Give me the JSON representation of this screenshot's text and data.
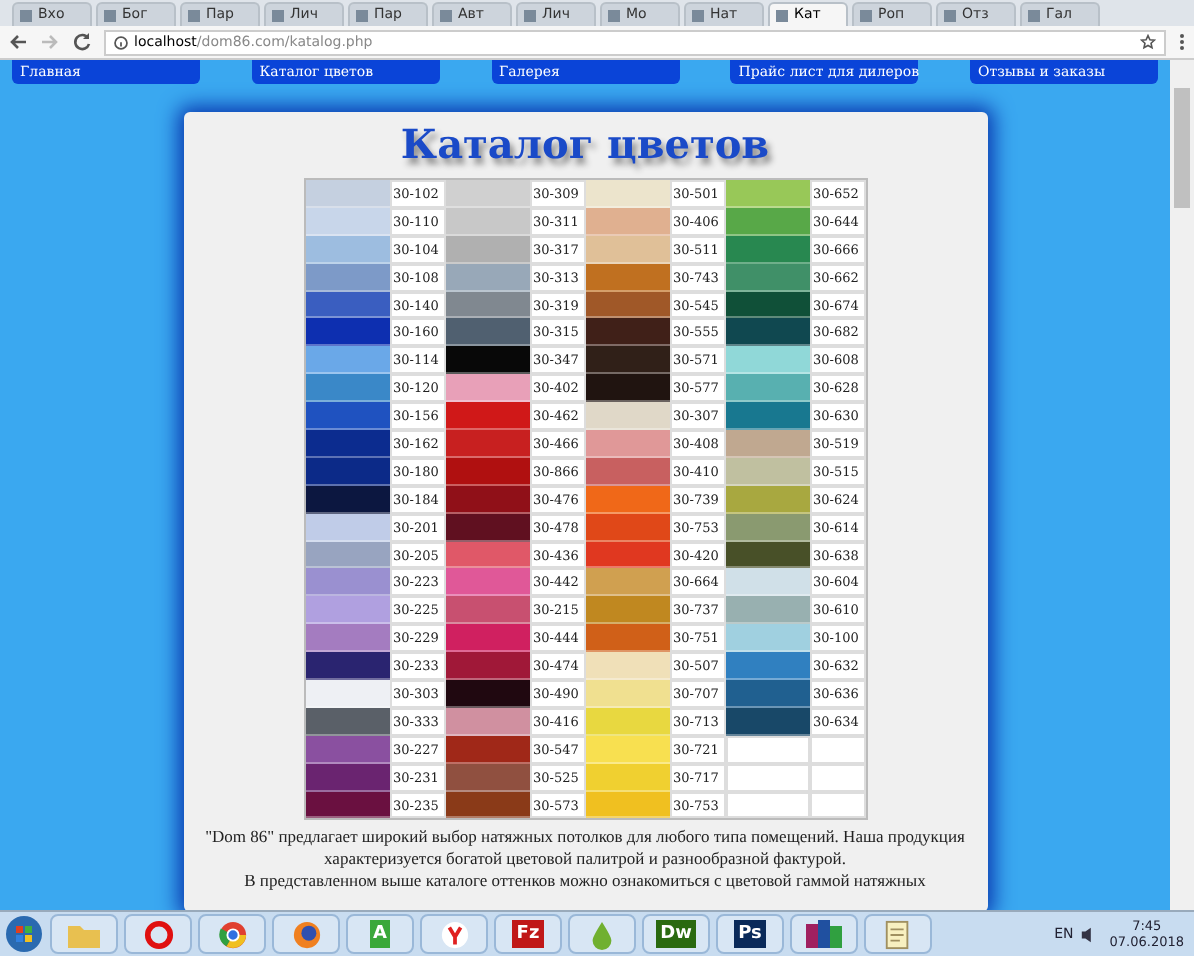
{
  "browser": {
    "tabs": [
      {
        "label": "Вхо",
        "selected": false
      },
      {
        "label": "Бог",
        "selected": false
      },
      {
        "label": "Пар",
        "selected": false
      },
      {
        "label": "Лич",
        "selected": false
      },
      {
        "label": "Пар",
        "selected": false
      },
      {
        "label": "Авт",
        "selected": false
      },
      {
        "label": "Лич",
        "selected": false
      },
      {
        "label": "Мо",
        "selected": false
      },
      {
        "label": "Нат",
        "selected": false
      },
      {
        "label": "Кат",
        "selected": true
      },
      {
        "label": "Роп",
        "selected": false
      },
      {
        "label": "Отз",
        "selected": false
      },
      {
        "label": "Гал",
        "selected": false
      }
    ],
    "url_host": "localhost",
    "url_path": "/dom86.com/katalog.php"
  },
  "nav": [
    "Главная",
    "Каталог цветов",
    "Галерея",
    "Прайс лист для дилеров",
    "Отзывы и заказы"
  ],
  "title": "Каталог цветов",
  "palette": [
    [
      {
        "code": "30-102",
        "color": "#c5d0e0"
      },
      {
        "code": "30-110",
        "color": "#c8d6ea"
      },
      {
        "code": "30-104",
        "color": "#9dbde0"
      },
      {
        "code": "30-108",
        "color": "#7d9ac8"
      },
      {
        "code": "30-140",
        "color": "#3a5ec0"
      },
      {
        "code": "30-160",
        "color": "#0d2fb0"
      },
      {
        "code": "30-114",
        "color": "#6aa8e8"
      },
      {
        "code": "30-120",
        "color": "#3a88c8"
      },
      {
        "code": "30-156",
        "color": "#1f52c0"
      },
      {
        "code": "30-162",
        "color": "#0c2c8f"
      },
      {
        "code": "30-180",
        "color": "#0c2a88"
      },
      {
        "code": "30-184",
        "color": "#0c1740"
      },
      {
        "code": "30-201",
        "color": "#c0cce8"
      },
      {
        "code": "30-205",
        "color": "#98a4c0"
      },
      {
        "code": "30-223",
        "color": "#9a90d0"
      },
      {
        "code": "30-225",
        "color": "#b0a0e0"
      },
      {
        "code": "30-229",
        "color": "#a47cc0"
      },
      {
        "code": "30-233",
        "color": "#2a2470"
      },
      {
        "code": "30-303",
        "color": "#eef0f4"
      },
      {
        "code": "30-333",
        "color": "#5a6068"
      },
      {
        "code": "30-227",
        "color": "#8a50a0"
      },
      {
        "code": "30-231",
        "color": "#6a2470"
      },
      {
        "code": "30-235",
        "color": "#6a1040"
      }
    ],
    [
      {
        "code": "30-309",
        "color": "#d0d0d0"
      },
      {
        "code": "30-311",
        "color": "#c8c8c8"
      },
      {
        "code": "30-317",
        "color": "#b0b0b0"
      },
      {
        "code": "30-313",
        "color": "#98a8b8"
      },
      {
        "code": "30-319",
        "color": "#808890"
      },
      {
        "code": "30-315",
        "color": "#506070"
      },
      {
        "code": "30-347",
        "color": "#080808"
      },
      {
        "code": "30-402",
        "color": "#e8a0b8"
      },
      {
        "code": "30-462",
        "color": "#d01818"
      },
      {
        "code": "30-466",
        "color": "#c82020"
      },
      {
        "code": "30-866",
        "color": "#b01010"
      },
      {
        "code": "30-476",
        "color": "#901018"
      },
      {
        "code": "30-478",
        "color": "#601020"
      },
      {
        "code": "30-436",
        "color": "#e05868"
      },
      {
        "code": "30-442",
        "color": "#e05898"
      },
      {
        "code": "30-215",
        "color": "#c85070"
      },
      {
        "code": "30-444",
        "color": "#d02060"
      },
      {
        "code": "30-474",
        "color": "#a01838"
      },
      {
        "code": "30-490",
        "color": "#200810"
      },
      {
        "code": "30-416",
        "color": "#d090a0"
      },
      {
        "code": "30-547",
        "color": "#a02818"
      },
      {
        "code": "30-525",
        "color": "#905040"
      },
      {
        "code": "30-573",
        "color": "#8a3a18"
      }
    ],
    [
      {
        "code": "30-501",
        "color": "#ece4cc"
      },
      {
        "code": "30-406",
        "color": "#e0b090"
      },
      {
        "code": "30-511",
        "color": "#e0c098"
      },
      {
        "code": "30-743",
        "color": "#c07020"
      },
      {
        "code": "30-545",
        "color": "#a05828"
      },
      {
        "code": "30-555",
        "color": "#402018"
      },
      {
        "code": "30-571",
        "color": "#302018"
      },
      {
        "code": "30-577",
        "color": "#201410"
      },
      {
        "code": "30-307",
        "color": "#e0d8c8"
      },
      {
        "code": "30-408",
        "color": "#e09898"
      },
      {
        "code": "30-410",
        "color": "#c86060"
      },
      {
        "code": "30-739",
        "color": "#f06818"
      },
      {
        "code": "30-753",
        "color": "#e04818"
      },
      {
        "code": "30-420",
        "color": "#e03820"
      },
      {
        "code": "30-664",
        "color": "#d0a050"
      },
      {
        "code": "30-737",
        "color": "#c08820"
      },
      {
        "code": "30-751",
        "color": "#d06018"
      },
      {
        "code": "30-507",
        "color": "#f0e0b8"
      },
      {
        "code": "30-707",
        "color": "#f0e090"
      },
      {
        "code": "30-713",
        "color": "#e8d840"
      },
      {
        "code": "30-721",
        "color": "#f8e050"
      },
      {
        "code": "30-717",
        "color": "#f0d030"
      },
      {
        "code": "30-753",
        "color": "#f0c020"
      }
    ],
    [
      {
        "code": "30-652",
        "color": "#98c858"
      },
      {
        "code": "30-644",
        "color": "#58a848"
      },
      {
        "code": "30-666",
        "color": "#288850"
      },
      {
        "code": "30-662",
        "color": "#409068"
      },
      {
        "code": "30-674",
        "color": "#105038"
      },
      {
        "code": "30-682",
        "color": "#104850"
      },
      {
        "code": "30-608",
        "color": "#90d8d8"
      },
      {
        "code": "30-628",
        "color": "#58b0b0"
      },
      {
        "code": "30-630",
        "color": "#187890"
      },
      {
        "code": "30-519",
        "color": "#c0a890"
      },
      {
        "code": "30-515",
        "color": "#c0c0a0"
      },
      {
        "code": "30-624",
        "color": "#a8a840"
      },
      {
        "code": "30-614",
        "color": "#8a9a70"
      },
      {
        "code": "30-638",
        "color": "#485028"
      },
      {
        "code": "30-604",
        "color": "#d0e0e8"
      },
      {
        "code": "30-610",
        "color": "#98b0b0"
      },
      {
        "code": "30-100",
        "color": "#a0d0e0"
      },
      {
        "code": "30-632",
        "color": "#3080c0"
      },
      {
        "code": "30-636",
        "color": "#206090"
      },
      {
        "code": "30-634",
        "color": "#184868"
      }
    ]
  ],
  "description": [
    "\"Dom 86\" предлагает широкий выбор натяжных потолков для любого типа помещений. Наша продукция характеризуется богатой цветовой палитрой и разнообразной фактурой.",
    "В представленном выше каталоге оттенков можно ознакомиться с цветовой гаммой натяжных"
  ],
  "taskbar": {
    "apps": [
      {
        "kind": "folder"
      },
      {
        "kind": "opera"
      },
      {
        "kind": "chrome"
      },
      {
        "kind": "firefox"
      },
      {
        "kind": "letter",
        "label": "A",
        "color": "#3aa83a"
      },
      {
        "kind": "yandex"
      },
      {
        "kind": "letter",
        "label": "Fz",
        "color": "#c01818"
      },
      {
        "kind": "drop"
      },
      {
        "kind": "letter",
        "label": "Dw",
        "color": "#2a6a10"
      },
      {
        "kind": "letter",
        "label": "Ps",
        "color": "#0a2a5a"
      },
      {
        "kind": "books"
      },
      {
        "kind": "notepad"
      }
    ],
    "language": "EN",
    "time": "7:45",
    "date": "07.06.2018"
  }
}
